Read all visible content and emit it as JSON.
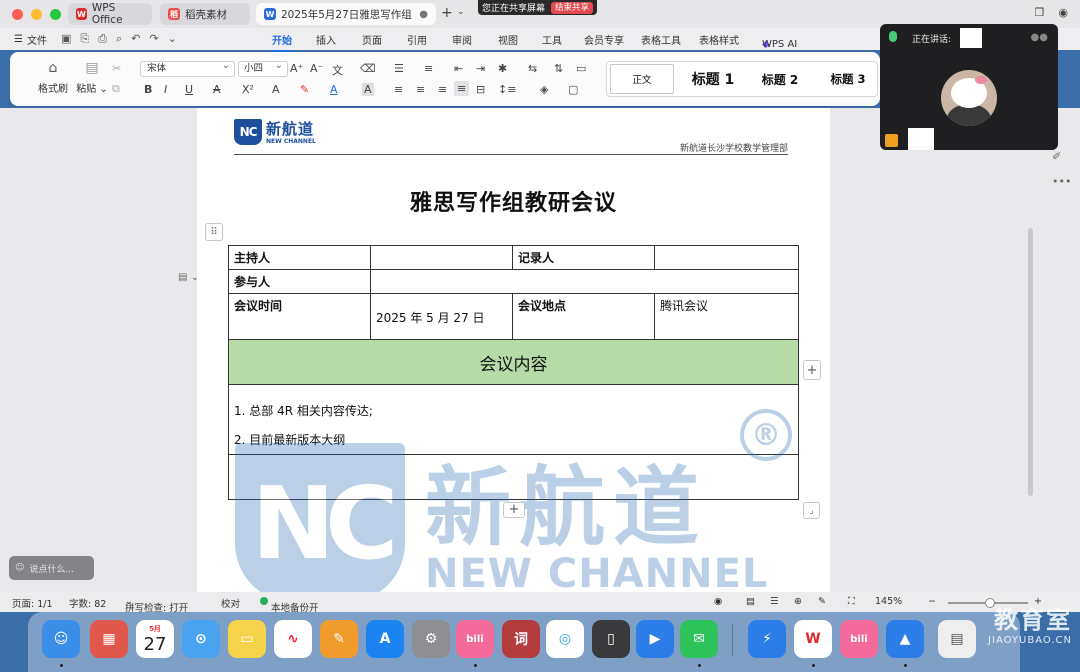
{
  "titlebar": {
    "tabs": [
      {
        "label": "WPS Office",
        "logo": "W"
      },
      {
        "label": "稻壳素材",
        "logo": "稻"
      },
      {
        "label": "2025年5月27日雅思写作组",
        "logo": "W"
      }
    ],
    "share_status": "您正在共享屏幕",
    "end_share": "结束共享"
  },
  "menu": {
    "file": "文件",
    "tabs": [
      "开始",
      "插入",
      "页面",
      "引用",
      "审阅",
      "视图",
      "工具",
      "会员专享",
      "表格工具",
      "表格样式",
      "WPS AI"
    ],
    "active": "开始"
  },
  "ribbon": {
    "format_painter": "格式刷",
    "paste": "粘贴",
    "font": "宋体",
    "font_size": "小四",
    "styles": [
      "正文",
      "标题 1",
      "标题 2",
      "标题 3"
    ]
  },
  "document": {
    "header_brand_cn": "新航道",
    "header_brand_en": "NEW CHANNEL",
    "header_badge": "NC",
    "header_right": "新航道长沙学校教学管理部",
    "title": "雅思写作组教研会议",
    "table": {
      "host_label": "主持人",
      "recorder_label": "记录人",
      "participants_label": "参与人",
      "time_label": "会议时间",
      "time_value": "2025 年 5 月 27 日",
      "place_label": "会议地点",
      "place_value": "腾讯会议",
      "content_header": "会议内容",
      "items": [
        "1.  总部 4R 相关内容传达;",
        "2.  目前最新版本大纲"
      ]
    },
    "watermark": {
      "badge": "NC",
      "cn": "新航道",
      "en": "NEW CHANNEL",
      "reg": "®"
    }
  },
  "video": {
    "speaking": "正在讲话:"
  },
  "statusbar": {
    "page": "页面: 1/1",
    "words": "字数: 82",
    "spellcheck": "拼写检查: 打开",
    "proof": "校对",
    "backup": "本地备份开",
    "zoom": "145%"
  },
  "chat_placeholder": "说点什么...",
  "dock": {
    "calendar_month": "5月",
    "calendar_day": "27",
    "ci_label": "词"
  },
  "corner_watermark": {
    "cn": "教育室",
    "en": "JIAOYUBAO.CN"
  }
}
